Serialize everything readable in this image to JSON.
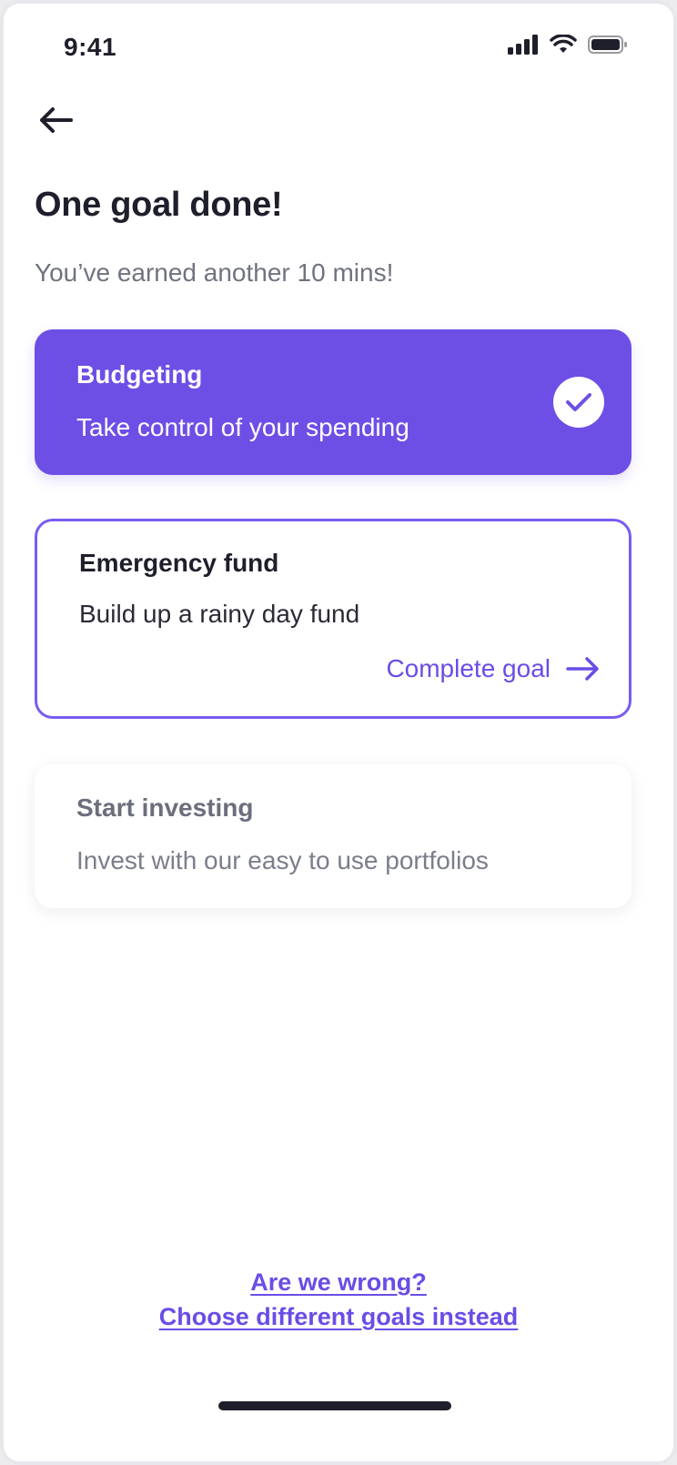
{
  "status_bar": {
    "time": "9:41",
    "icons": [
      "cellular-signal-icon",
      "wifi-icon",
      "battery-icon"
    ]
  },
  "nav": {
    "back_icon": "arrow-left-icon"
  },
  "header": {
    "title": "One goal done!",
    "subtitle": "You’ve earned another 10 mins!"
  },
  "goals": [
    {
      "title": "Budgeting",
      "description": "Take control of your spending",
      "status": "completed",
      "icon": "checkmark-icon"
    },
    {
      "title": "Emergency fund",
      "description": "Build up a rainy day fund",
      "status": "active",
      "action_label": "Complete goal",
      "action_icon": "arrow-right-icon"
    },
    {
      "title": "Start investing",
      "description": "Invest with our easy to use portfolios",
      "status": "pending"
    }
  ],
  "footer": {
    "line1": "Are we wrong?",
    "line2": "Choose different goals instead"
  },
  "colors": {
    "accent": "#6D4FE6",
    "text_primary": "#1E1F2B",
    "text_secondary": "#70737F",
    "background": "#FFFFFF"
  }
}
